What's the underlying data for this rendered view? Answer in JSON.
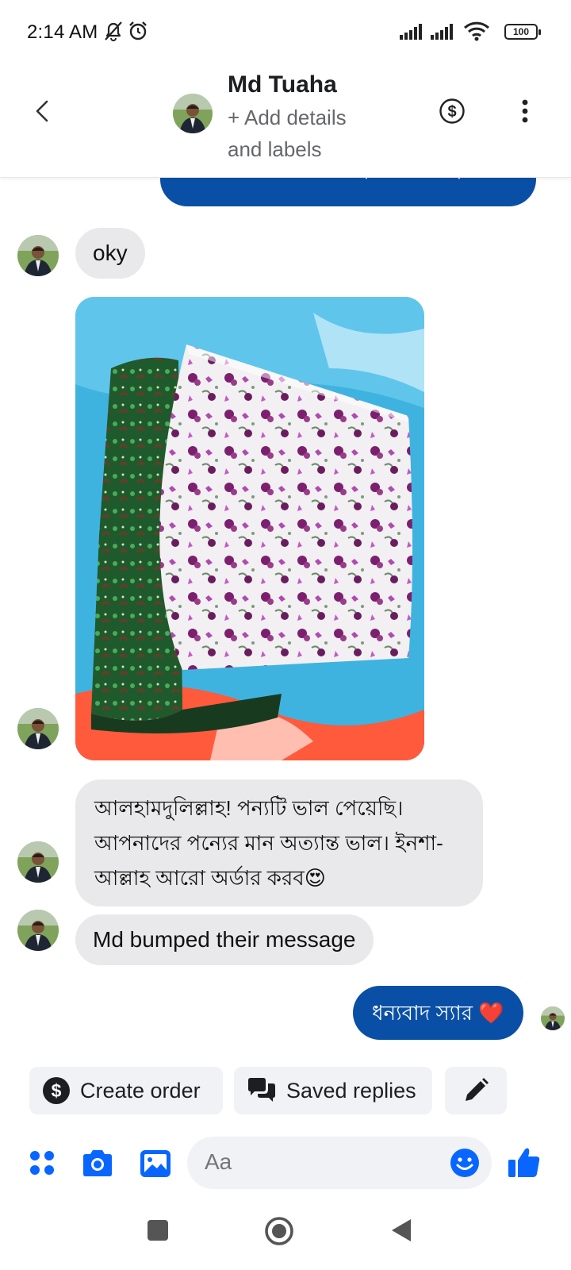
{
  "status_bar": {
    "time": "2:14 AM",
    "battery": "100"
  },
  "header": {
    "contact_name": "Md Tuaha",
    "subtitle": "+ Add details and labels"
  },
  "messages": {
    "previous_outgoing": "আগামীকাল পাবেন ইনশাআল্লাহ স্যার",
    "incoming_oky": "oky",
    "incoming_review": "আলহামদুলিল্লাহ! পন্যটি ভাল পেয়েছি। আপনাদের পন্যের মান অত্যান্ত ভাল। ইনশা-আল্লাহ আরো অর্ডার করব😍",
    "bumped_notice": "Md bumped their message",
    "outgoing_thanks": "ধন্যবাদ স্যার ❤️"
  },
  "quick_actions": {
    "create_order": "Create order",
    "saved_replies": "Saved replies"
  },
  "composer": {
    "placeholder": "Aa"
  },
  "colors": {
    "brand_blue": "#0a4fa6",
    "icon_blue": "#0866ff",
    "incoming_bubble": "#e9e9eb"
  }
}
